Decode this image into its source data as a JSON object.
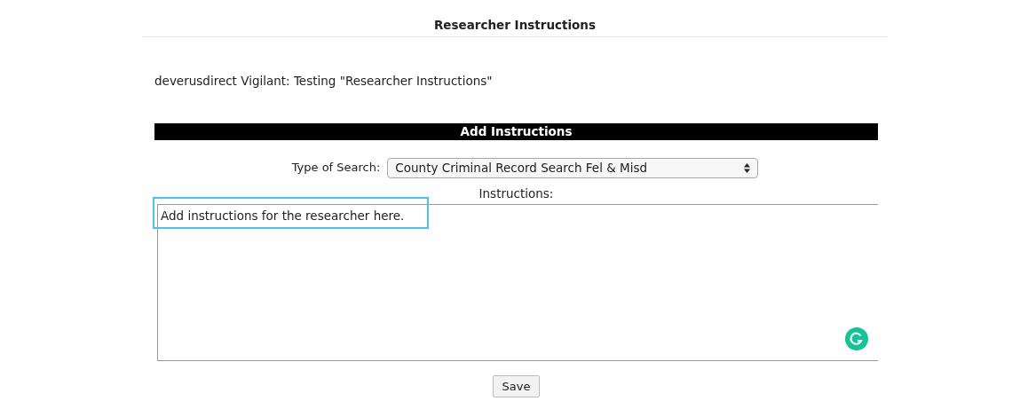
{
  "page": {
    "title": "Researcher Instructions",
    "subtitle": "deverusdirect Vigilant: Testing \"Researcher Instructions\""
  },
  "form": {
    "heading": "Add Instructions",
    "search_type": {
      "label": "Type of Search:",
      "value": "County Criminal Record Search Fel & Misd"
    },
    "instructions": {
      "label": "Instructions:",
      "value": "Add instructions for the researcher here.",
      "highlighted": true
    },
    "save_button": "Save"
  }
}
